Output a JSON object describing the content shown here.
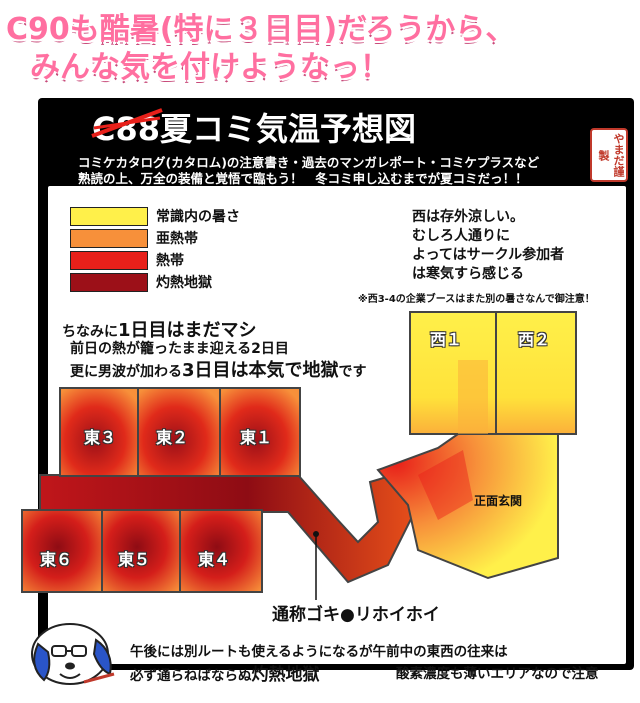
{
  "headline": {
    "line1": "C90も酷暑(特に３日目)だろうから、",
    "line2": "みんな気を付けようなっ！"
  },
  "title": {
    "struck": "C88",
    "main": "夏コミ気温予想図"
  },
  "intro": {
    "line1": "コミケカタログ(カタロム)の注意書き・過去のマンガレポート・コミケプラスなど",
    "line2": "熟読の上、万全の装備と覚悟で臨もう！　冬コミ申し込むまでが夏コミだっ！！"
  },
  "seal": {
    "text": "やまだ謹製"
  },
  "legend": [
    {
      "label": "常識内の暑さ",
      "color": "#fff04a"
    },
    {
      "label": "亜熱帯",
      "color": "#f7903a"
    },
    {
      "label": "熱帯",
      "color": "#e8201a"
    },
    {
      "label": "灼熱地獄",
      "color": "#9c1018"
    }
  ],
  "west_note": {
    "line1": "西は存外涼しい。",
    "line2": "むしろ人通りに",
    "line3": "よってはサークル参加者",
    "line4": "は寒気すら感じる"
  },
  "small_note": "※西3-4の企業ブースはまた別の暑さなんで御注意！",
  "east_note": {
    "l1a": "ちなみに",
    "l1b": "1日目はまだマシ",
    "l2": "前日の熱が籠ったまま迎える2日目",
    "l3a": "更に男波が加わる",
    "l3b": "3日目は本気で地獄",
    "l3c": "です"
  },
  "halls": {
    "east3": "東３",
    "east2": "東２",
    "east1": "東１",
    "east6": "東６",
    "east5": "東５",
    "east4": "東４",
    "west1": "西１",
    "west2": "西２",
    "gate": "正面玄関"
  },
  "callout": "通称ゴキ●リホイホイ",
  "bottom": {
    "line1": "午後には別ルートも使えるようになるが午前中の東西の往来は",
    "l2a": "必ず通らねばならぬ",
    "l2b": "灼熱地獄",
    "l2c": "酸素濃度も薄いエリアなので注意"
  }
}
